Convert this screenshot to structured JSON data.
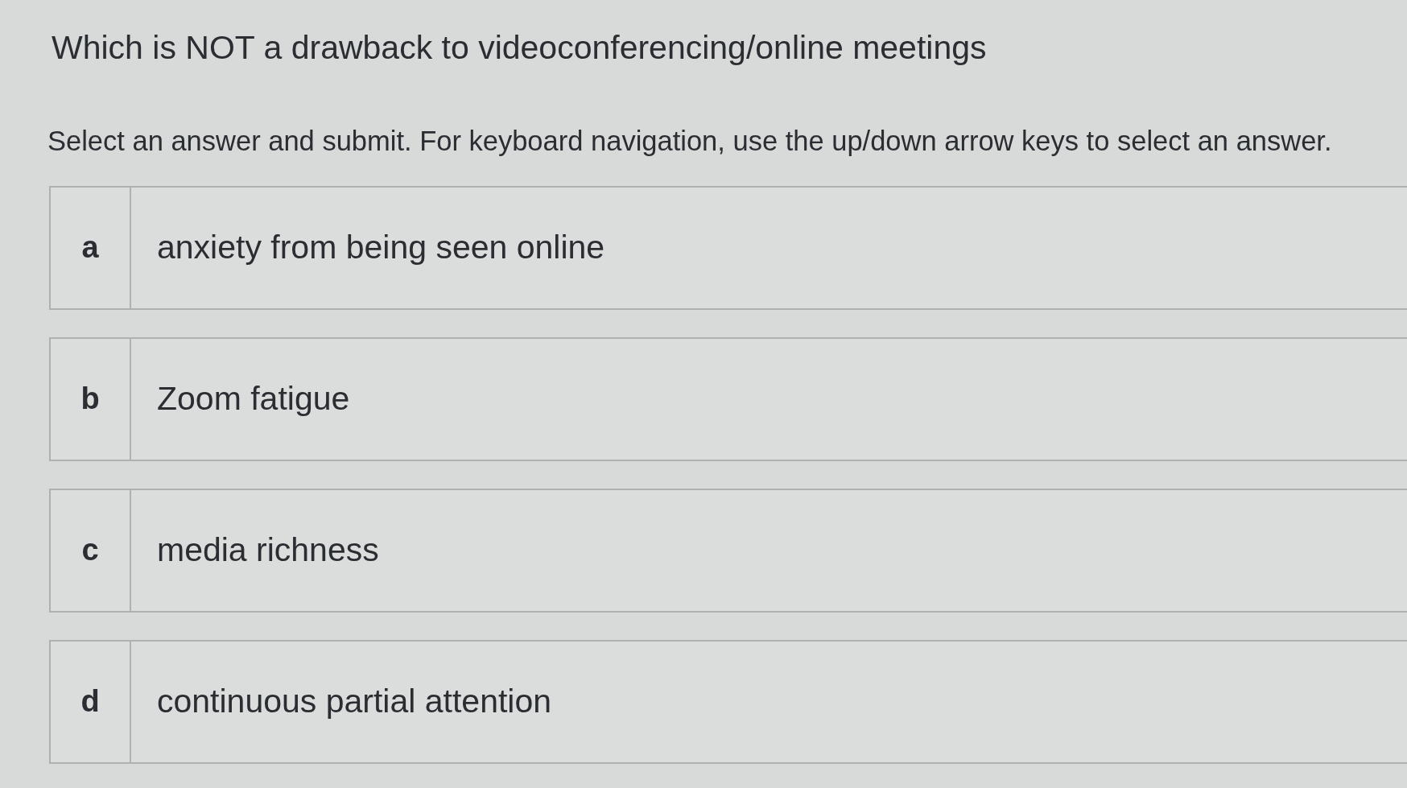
{
  "question": {
    "title": "Which is NOT a drawback to videoconferencing/online meetings",
    "instructions": "Select an answer and submit. For keyboard navigation, use the up/down arrow keys to select an answer."
  },
  "options": [
    {
      "letter": "a",
      "text": "anxiety from being seen online",
      "selected": false
    },
    {
      "letter": "b",
      "text": "Zoom fatigue",
      "selected": false
    },
    {
      "letter": "c",
      "text": "media richness",
      "selected": false
    },
    {
      "letter": "d",
      "text": "continuous partial attention",
      "selected": false
    }
  ]
}
